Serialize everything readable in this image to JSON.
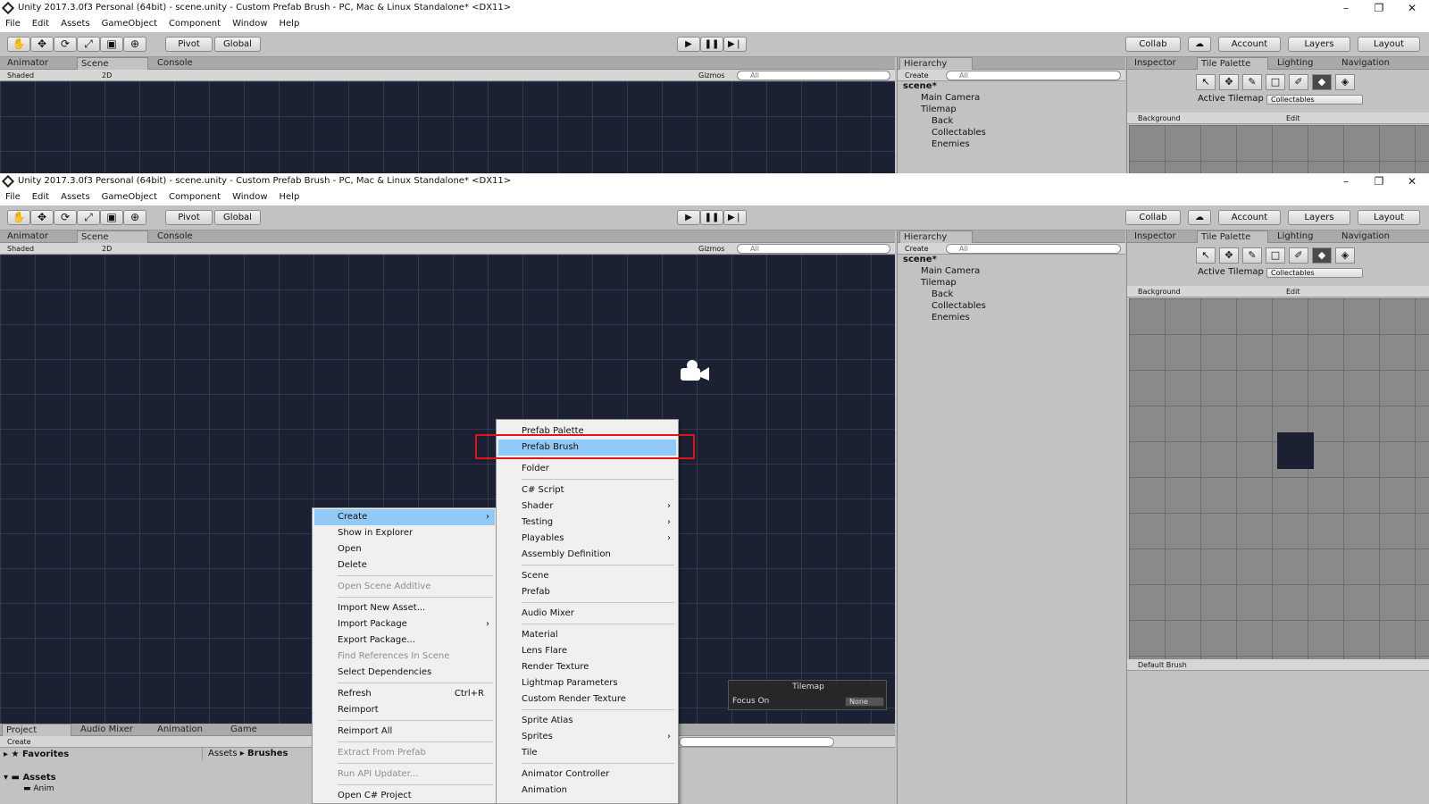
{
  "window": {
    "title": "Unity 2017.3.0f3 Personal (64bit) - scene.unity - Custom Prefab Brush - PC, Mac & Linux Standalone* <DX11>",
    "minimize": "–",
    "restore": "❐",
    "close": "✕"
  },
  "menubar": [
    "File",
    "Edit",
    "Assets",
    "GameObject",
    "Component",
    "Window",
    "Help"
  ],
  "toolbar": {
    "tools": [
      "✋",
      "✥",
      "⟳",
      "⤢",
      "▣",
      "⊕"
    ],
    "pivot": "Pivot",
    "global": "Global",
    "play": "▶",
    "pause": "❚❚",
    "step": "▶❘",
    "collab": "Collab",
    "cloud": "☁",
    "account": "Account",
    "layers": "Layers",
    "layout": "Layout"
  },
  "scene_tabs": {
    "animator": "Animator",
    "scene": "Scene",
    "console": "Console"
  },
  "scene_bar": {
    "shaded": "Shaded",
    "mode2d": "2D",
    "gizmos": "Gizmos",
    "search": "All"
  },
  "hierarchy": {
    "tab": "Hierarchy",
    "create": "Create",
    "search": "All",
    "scene": "scene*",
    "items": [
      "Main Camera",
      "Tilemap",
      "Back",
      "Collectables",
      "Enemies"
    ]
  },
  "right_tabs": {
    "inspector": "Inspector",
    "tile_palette": "Tile Palette",
    "lighting": "Lighting",
    "navigation": "Navigation"
  },
  "tile_palette": {
    "active_tilemap_label": "Active Tilemap",
    "active_tilemap_value": "Collectables",
    "palette": "Background",
    "edit": "Edit",
    "brush": "Default Brush"
  },
  "tilemap_overlay": {
    "title": "Tilemap",
    "focus_label": "Focus On",
    "focus_value": "None"
  },
  "project": {
    "tabs": {
      "project": "Project",
      "audio_mixer": "Audio Mixer",
      "animation": "Animation",
      "game": "Game"
    },
    "create": "Create",
    "favorites": "Favorites",
    "assets": "Assets",
    "anim": "Anim",
    "breadcrumb_root": "Assets",
    "breadcrumb_sep": "▸",
    "breadcrumb_leaf": "Brushes"
  },
  "context_menu": {
    "create": "Create",
    "show_in_explorer": "Show in Explorer",
    "open": "Open",
    "delete": "Delete",
    "open_scene_additive": "Open Scene Additive",
    "import_new_asset": "Import New Asset...",
    "import_package": "Import Package",
    "export_package": "Export Package...",
    "find_references": "Find References In Scene",
    "select_dependencies": "Select Dependencies",
    "refresh": "Refresh",
    "refresh_shortcut": "Ctrl+R",
    "reimport": "Reimport",
    "reimport_all": "Reimport All",
    "extract_from_prefab": "Extract From Prefab",
    "run_api_updater": "Run API Updater...",
    "open_cs_project": "Open C# Project"
  },
  "create_menu": {
    "prefab_palette": "Prefab Palette",
    "prefab_brush": "Prefab Brush",
    "folder": "Folder",
    "cs_script": "C# Script",
    "shader": "Shader",
    "testing": "Testing",
    "playables": "Playables",
    "assembly_definition": "Assembly Definition",
    "scene": "Scene",
    "prefab": "Prefab",
    "audio_mixer": "Audio Mixer",
    "material": "Material",
    "lens_flare": "Lens Flare",
    "render_texture": "Render Texture",
    "lightmap_parameters": "Lightmap Parameters",
    "custom_render_texture": "Custom Render Texture",
    "sprite_atlas": "Sprite Atlas",
    "sprites": "Sprites",
    "tile": "Tile",
    "animator_controller": "Animator Controller",
    "animation": "Animation"
  }
}
